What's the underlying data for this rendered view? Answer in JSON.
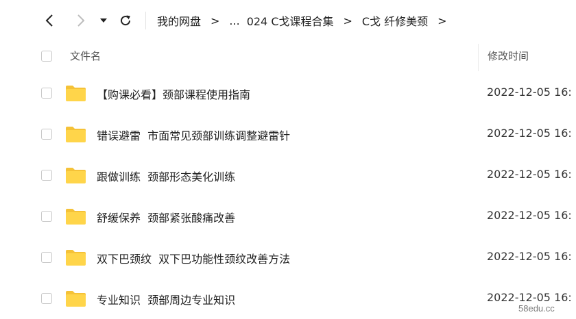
{
  "toolbar": {
    "back_icon": "chevron-left-icon",
    "forward_icon": "chevron-right-icon",
    "history_icon": "caret-down-icon",
    "refresh_icon": "refresh-icon"
  },
  "breadcrumb": {
    "items": [
      "我的网盘",
      "...",
      "024 C戈课程合集",
      "C戈 纤修美颈"
    ],
    "separator": ">"
  },
  "table": {
    "col_name": "文件名",
    "col_mtime": "修改时间"
  },
  "files": [
    {
      "name": "【购课必看】颈部课程使用指南",
      "modified": "2022-12-05 16:"
    },
    {
      "name": "错误避雷  市面常见颈部训练调整避雷针",
      "modified": "2022-12-05 16:"
    },
    {
      "name": "跟做训练  颈部形态美化训练",
      "modified": "2022-12-05 16:"
    },
    {
      "name": "舒缓保养  颈部紧张酸痛改善",
      "modified": "2022-12-05 16:"
    },
    {
      "name": "双下巴颈纹  双下巴功能性颈纹改善方法",
      "modified": "2022-12-05 16:"
    },
    {
      "name": "专业知识  颈部周边专业知识",
      "modified": "2022-12-05 16:"
    }
  ],
  "colors": {
    "folder_body": "#FFD54A",
    "folder_tab": "#F5C238",
    "checkbox_border": "#C9C9C9"
  },
  "watermark": "58edu.cc"
}
